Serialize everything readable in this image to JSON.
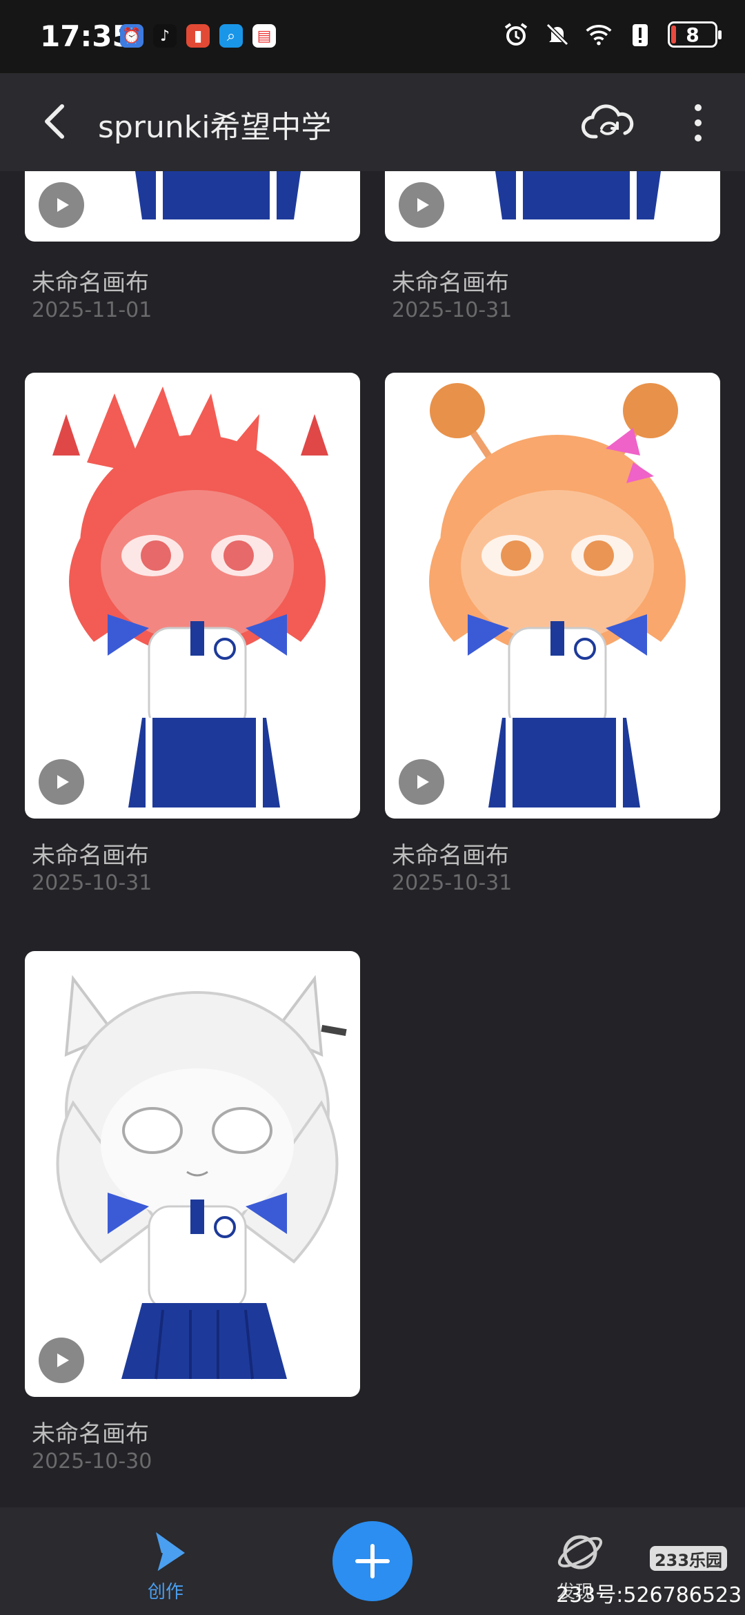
{
  "status_bar": {
    "time": "17:35",
    "battery_level": "8",
    "app_icons": [
      "clock-app-icon",
      "tiktok-app-icon",
      "battery-app-icon",
      "search-app-icon",
      "calendar-app-icon"
    ],
    "system_icons": [
      "alarm-icon",
      "silent-bell-icon",
      "wifi-icon",
      "alert-icon"
    ]
  },
  "header": {
    "title": "sprunki希望中学",
    "back_icon": "back-arrow-icon",
    "cloud_icon": "cloud-sync-icon",
    "more_icon": "more-vertical-icon"
  },
  "canvases": [
    {
      "name": "未命名画布",
      "date": "2025-11-01",
      "hair_color": "#e0e0e0"
    },
    {
      "name": "未命名画布",
      "date": "2025-10-31",
      "hair_color": "#e0e0e0"
    },
    {
      "name": "未命名画布",
      "date": "2025-10-31",
      "hair_color": "#f25c54"
    },
    {
      "name": "未命名画布",
      "date": "2025-10-31",
      "hair_color": "#f9a76c"
    },
    {
      "name": "未命名画布",
      "date": "2025-10-30",
      "hair_color": "#f2f2f2"
    }
  ],
  "bottom_nav": {
    "create_label": "创作",
    "discover_label": "发现",
    "add_icon": "plus-icon"
  },
  "watermark": {
    "logo_text": "233乐园",
    "account_text": "233号:526786523"
  },
  "colors": {
    "accent": "#2b8ef0",
    "background": "#232226",
    "uniform_blue": "#1d3a9a"
  }
}
